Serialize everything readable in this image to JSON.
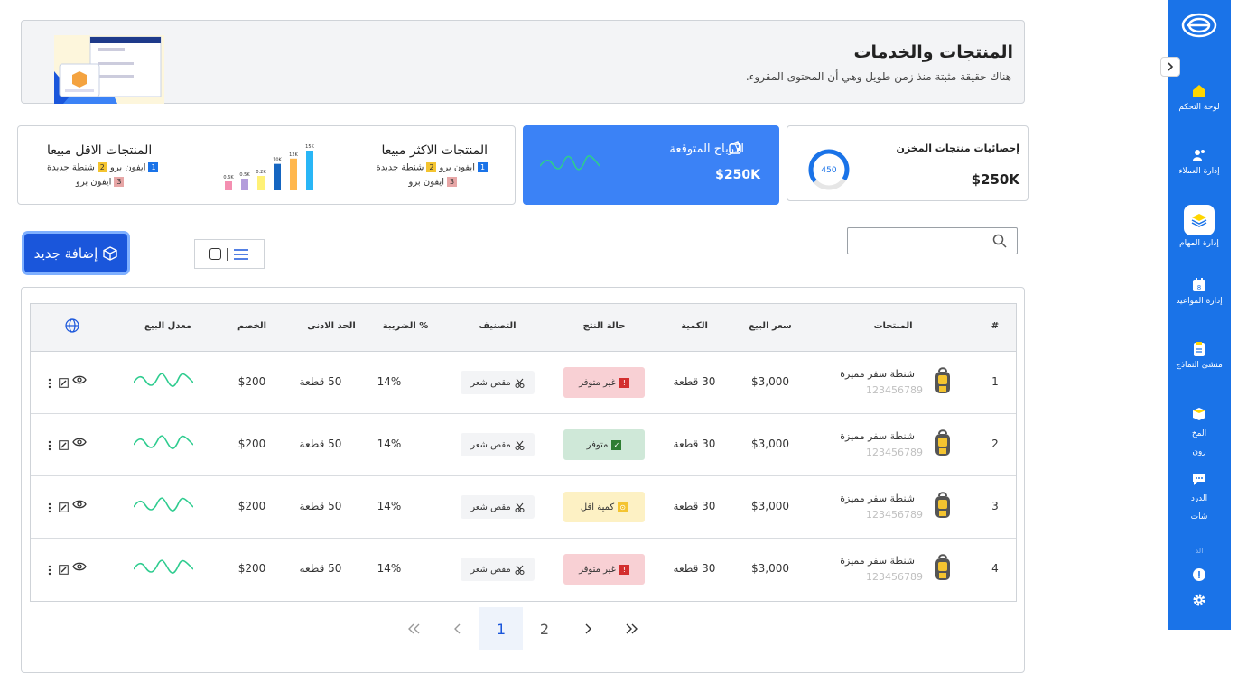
{
  "sidebar": {
    "items": [
      {
        "label": "لوحة التحكم"
      },
      {
        "label": "إدارة العملاء"
      },
      {
        "label": "إدارة المهام"
      },
      {
        "label": "إدارة المواعيد"
      },
      {
        "label": "منشئ النماذج"
      },
      {
        "label_line1": "المخ",
        "label_line2": "زون"
      },
      {
        "label_line1": "الدرد",
        "label_line2": "شات"
      },
      {
        "label": "الد"
      }
    ]
  },
  "banner": {
    "title": "المنتجات والخدمات",
    "subtitle": "هناك حقيقة مثبتة منذ زمن طويل وهي أن المحتوى المقروء."
  },
  "stats": {
    "inventory": {
      "title": "إحصائيات منتجات المخزن",
      "gauge_value": "450",
      "gauge_fraction": 0.7,
      "amount": "$250K"
    },
    "profits": {
      "title": "الارباح المتوقعة",
      "amount": "$250K"
    },
    "best_selling": {
      "title": "المنتجات الاكثر مبيعا",
      "line1_a": "ايفون برو",
      "line1_b": "شنطة جديدة",
      "line2": "ايفون برو",
      "n1": "1",
      "n2": "2",
      "n3": "3"
    },
    "least_selling": {
      "title": "المنتجات الاقل مبيعا",
      "line1_a": "ايفون برو",
      "line1_b": "شنطة جديدة",
      "line2": "ايفون برو",
      "n1": "1",
      "n2": "2",
      "n3": "3"
    },
    "mini_chart": {
      "labels": [
        "0.6K",
        "0.5K",
        "0.2K",
        "10K",
        "12K",
        "15K"
      ],
      "values": [
        0.6,
        0.5,
        0.2,
        10,
        12,
        15
      ],
      "colors": [
        "#f48fb1",
        "#b39ddb",
        "#fff176",
        "#1565c0",
        "#ffb74d",
        "#29b6f6"
      ]
    }
  },
  "toolbar": {
    "search_placeholder": "",
    "add_label": "إضافة جديد"
  },
  "table": {
    "headers": {
      "index": "#",
      "products": "المنتجات",
      "price": "سعر البيع",
      "quantity": "الكمية",
      "status": "حالة النتج",
      "category": "التصنيف",
      "tax": "الضريبة %",
      "min": "الحد الادنى",
      "discount": "الخصم",
      "sales_rate": "معدل البيع"
    },
    "rows": [
      {
        "index": "1",
        "name": "شنطة سفر مميزة",
        "code": "123456789",
        "price": "$3,000",
        "quantity": "30 قطعة",
        "status": "غير متوفر",
        "status_type": "red",
        "category": "مقص شعر",
        "tax": "14%",
        "min": "50 قطعة",
        "discount": "$200"
      },
      {
        "index": "2",
        "name": "شنطة سفر مميزة",
        "code": "123456789",
        "price": "$3,000",
        "quantity": "30 قطعة",
        "status": "متوفر",
        "status_type": "green",
        "category": "مقص شعر",
        "tax": "14%",
        "min": "50 قطعة",
        "discount": "$200"
      },
      {
        "index": "3",
        "name": "شنطة سفر مميزة",
        "code": "123456789",
        "price": "$3,000",
        "quantity": "30 قطعة",
        "status": "كمية اقل",
        "status_type": "yellow",
        "category": "مقص شعر",
        "tax": "14%",
        "min": "50 قطعة",
        "discount": "$200"
      },
      {
        "index": "4",
        "name": "شنطة سفر مميزة",
        "code": "123456789",
        "price": "$3,000",
        "quantity": "30 قطعة",
        "status": "غير متوفر",
        "status_type": "red",
        "category": "مقص شعر",
        "tax": "14%",
        "min": "50 قطعة",
        "discount": "$200"
      }
    ]
  },
  "pagination": {
    "first": "«",
    "prev": "‹",
    "page1": "1",
    "page2": "2",
    "next": "›",
    "last": "»"
  },
  "colors": {
    "primary": "#1a73e8",
    "button": "#1a56db",
    "profit_card": "#3b82f6",
    "spark": "#2ecc8f"
  }
}
